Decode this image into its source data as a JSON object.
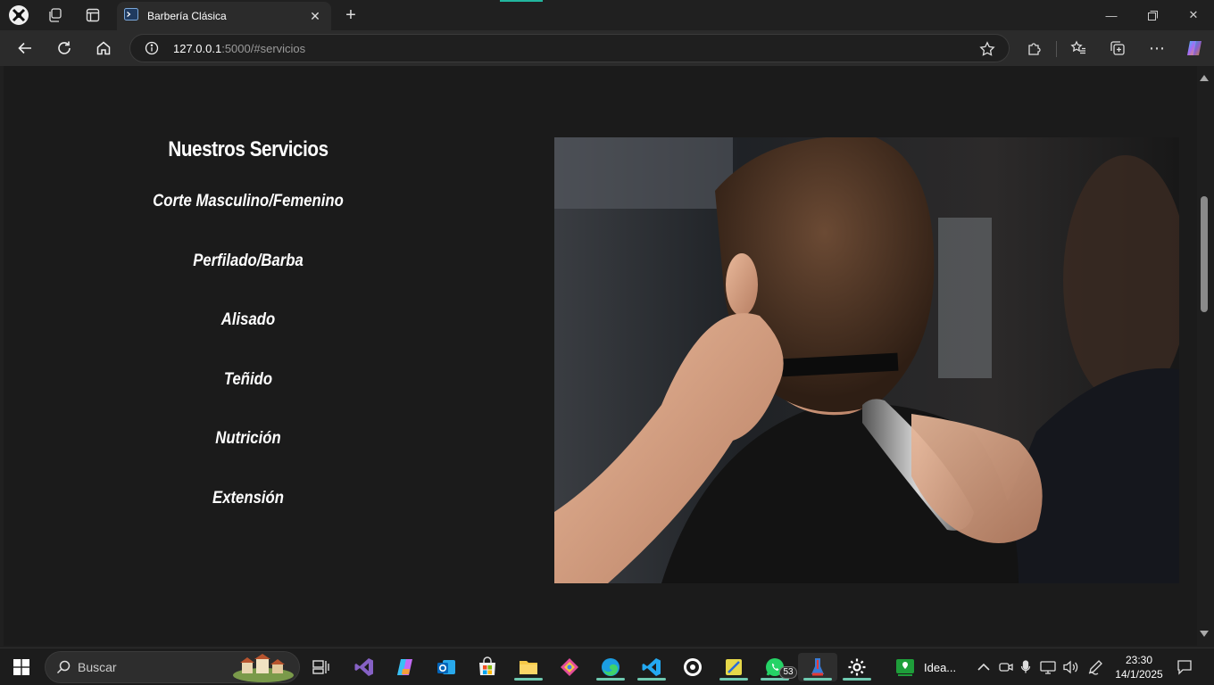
{
  "browser": {
    "tab_title": "Barbería Clásica",
    "url_host": "127.0.0.1",
    "url_rest": ":5000/#servicios"
  },
  "page": {
    "heading": "Nuestros Servicios",
    "services": [
      "Corte Masculino/Femenino",
      "Perfilado/Barba",
      "Alisado",
      "Teñido",
      "Nutrición",
      "Extensión"
    ],
    "photo_alt": "barber-cutting-hair-photo"
  },
  "taskbar": {
    "search_placeholder": "Buscar",
    "whatsapp_badge": "53",
    "app_label": "Idea...",
    "time": "23:30",
    "date": "14/1/2025"
  }
}
